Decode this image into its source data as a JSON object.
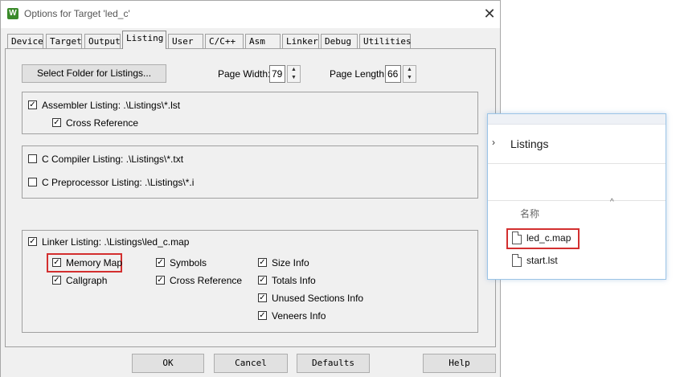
{
  "dialog": {
    "title": "Options for Target 'led_c'",
    "app_icon_glyph": "W",
    "close_glyph": "✕",
    "tabs": [
      "Device",
      "Target",
      "Output",
      "Listing",
      "User",
      "C/C++",
      "Asm",
      "Linker",
      "Debug",
      "Utilities"
    ],
    "active_tab": "Listing"
  },
  "listing": {
    "select_folder_label": "Select Folder for Listings...",
    "page_width_label": "Page Width:",
    "page_width_value": "79",
    "page_length_label": "Page Length:",
    "page_length_value": "66",
    "assembler": {
      "label": "Assembler Listing:  .\\Listings\\*.lst",
      "checked": true,
      "cross_reference_label": "Cross Reference",
      "cross_reference_checked": true
    },
    "c_compiler": {
      "label": "C Compiler Listing:  .\\Listings\\*.txt",
      "checked": false
    },
    "c_preprocessor": {
      "label": "C Preprocessor Listing:  .\\Listings\\*.i",
      "checked": false
    },
    "linker": {
      "label": "Linker Listing:  .\\Listings\\led_c.map",
      "checked": true,
      "options": {
        "memory_map": {
          "label": "Memory Map",
          "checked": true
        },
        "callgraph": {
          "label": "Callgraph",
          "checked": true
        },
        "symbols": {
          "label": "Symbols",
          "checked": true
        },
        "cross_reference": {
          "label": "Cross Reference",
          "checked": true
        },
        "size_info": {
          "label": "Size Info",
          "checked": true
        },
        "totals_info": {
          "label": "Totals Info",
          "checked": true
        },
        "unused_sections_info": {
          "label": "Unused Sections Info",
          "checked": true
        },
        "veneers_info": {
          "label": "Veneers Info",
          "checked": true
        }
      }
    }
  },
  "footer": {
    "ok": "OK",
    "cancel": "Cancel",
    "defaults": "Defaults",
    "help": "Help"
  },
  "explorer": {
    "folder_title": "Listings",
    "chevron_glyph": "›",
    "sort_glyph": "^",
    "column_header": "名称",
    "files": [
      "led_c.map",
      "start.lst"
    ]
  },
  "colors": {
    "highlight": "#d32f2f",
    "check_glyph": "✓"
  }
}
